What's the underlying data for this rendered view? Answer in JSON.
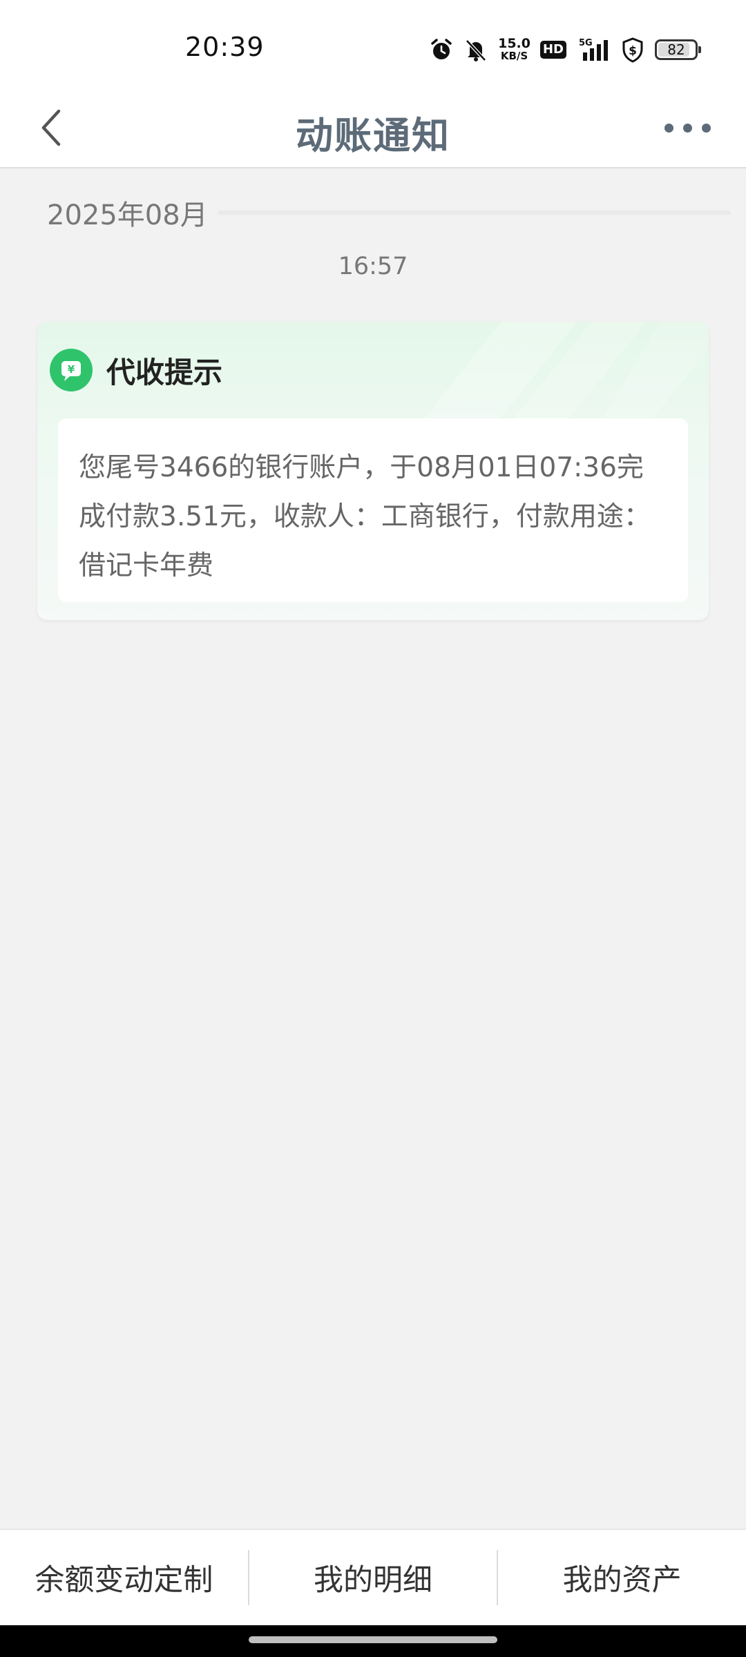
{
  "status_bar": {
    "time": "20:39",
    "net_speed_value": "15.0",
    "net_speed_unit": "KB/S",
    "hd_label": "HD",
    "signal_label": "5G",
    "battery_level": "82",
    "icons": [
      "alarm-icon",
      "mute-bell-icon",
      "hd-icon",
      "signal-5g-icon",
      "shield-dollar-icon",
      "battery-icon"
    ]
  },
  "nav": {
    "title": "动账通知",
    "back_icon": "chevron-left-icon",
    "more_icon": "more-dots-icon"
  },
  "feed": {
    "month_label": "2025年08月",
    "message_time": "16:57"
  },
  "card": {
    "icon": "yuan-message-icon",
    "icon_color": "#2fc46b",
    "title": "代收提示",
    "body": "您尾号3466的银行账户，于08月01日07:36完成付款3.51元，收款人：工商银行，付款用途：借记卡年费"
  },
  "bottom_bar": {
    "items": [
      "余额变动定制",
      "我的明细",
      "我的资产"
    ]
  },
  "colors": {
    "nav_title": "#5d6b78",
    "background": "#f2f2f2",
    "accent_green": "#2fc46b"
  }
}
